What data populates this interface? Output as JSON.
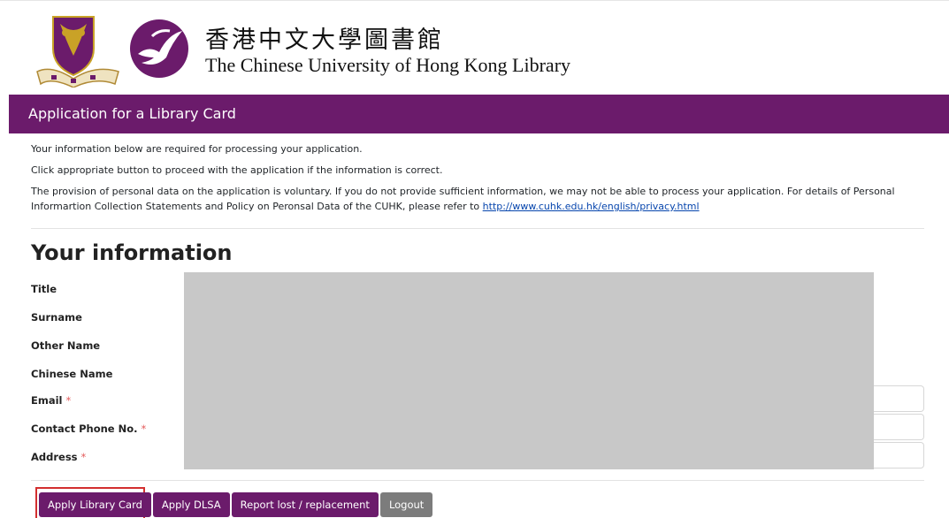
{
  "header": {
    "library_name_zh": "香港中文大學圖書館",
    "library_name_en": "The Chinese University of Hong Kong Library",
    "icons": [
      "university-crest-icon",
      "library-swallow-logo-icon"
    ]
  },
  "banner": {
    "title": "Application for a Library Card"
  },
  "intro": {
    "line1": "Your information below are required for processing your application.",
    "line2": "Click appropriate button to proceed with the application if the information is correct.",
    "line3_text": "The provision of personal data on the application is voluntary. If you do not provide sufficient information, we may not be able to process your application. For details of Personal Informartion Collection Statements and Policy on Peronsal Data of the CUHK, please refer to ",
    "privacy_link": "http://www.cuhk.edu.hk/english/privacy.html"
  },
  "form": {
    "section_title": "Your information",
    "required_marker": "*",
    "labels": {
      "title": "Title",
      "surname": "Surname",
      "other_name": "Other Name",
      "chinese_name": "Chinese Name",
      "email": "Email",
      "phone": "Contact Phone No.",
      "address": "Address"
    }
  },
  "actions": {
    "apply_card": "Apply Library Card",
    "apply_dlsa": "Apply DLSA",
    "report_lost": "Report lost / replacement",
    "logout": "Logout"
  },
  "colors": {
    "brand_purple": "#6b1b6b",
    "logout_gray": "#7c7c7c",
    "required_red": "#e45b5b",
    "focus_red": "#d32f2f"
  }
}
